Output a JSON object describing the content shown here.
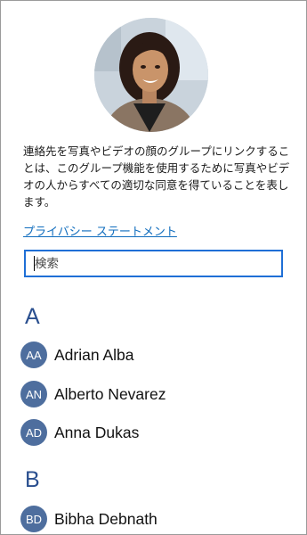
{
  "description": "連絡先を写真やビデオの顔のグループにリンクすることは、このグループ機能を使用するために写真やビデオの人からすべての適切な同意を得ていることを表します。",
  "privacy_link": "プライバシー ステートメント",
  "search": {
    "placeholder": "検索"
  },
  "groups": [
    {
      "letter": "A",
      "contacts": [
        {
          "initials": "AA",
          "name": "Adrian Alba"
        },
        {
          "initials": "AN",
          "name": "Alberto Nevarez"
        },
        {
          "initials": "AD",
          "name": "Anna Dukas"
        }
      ]
    },
    {
      "letter": "B",
      "contacts": [
        {
          "initials": "BD",
          "name": "Bibha Debnath"
        }
      ]
    }
  ]
}
